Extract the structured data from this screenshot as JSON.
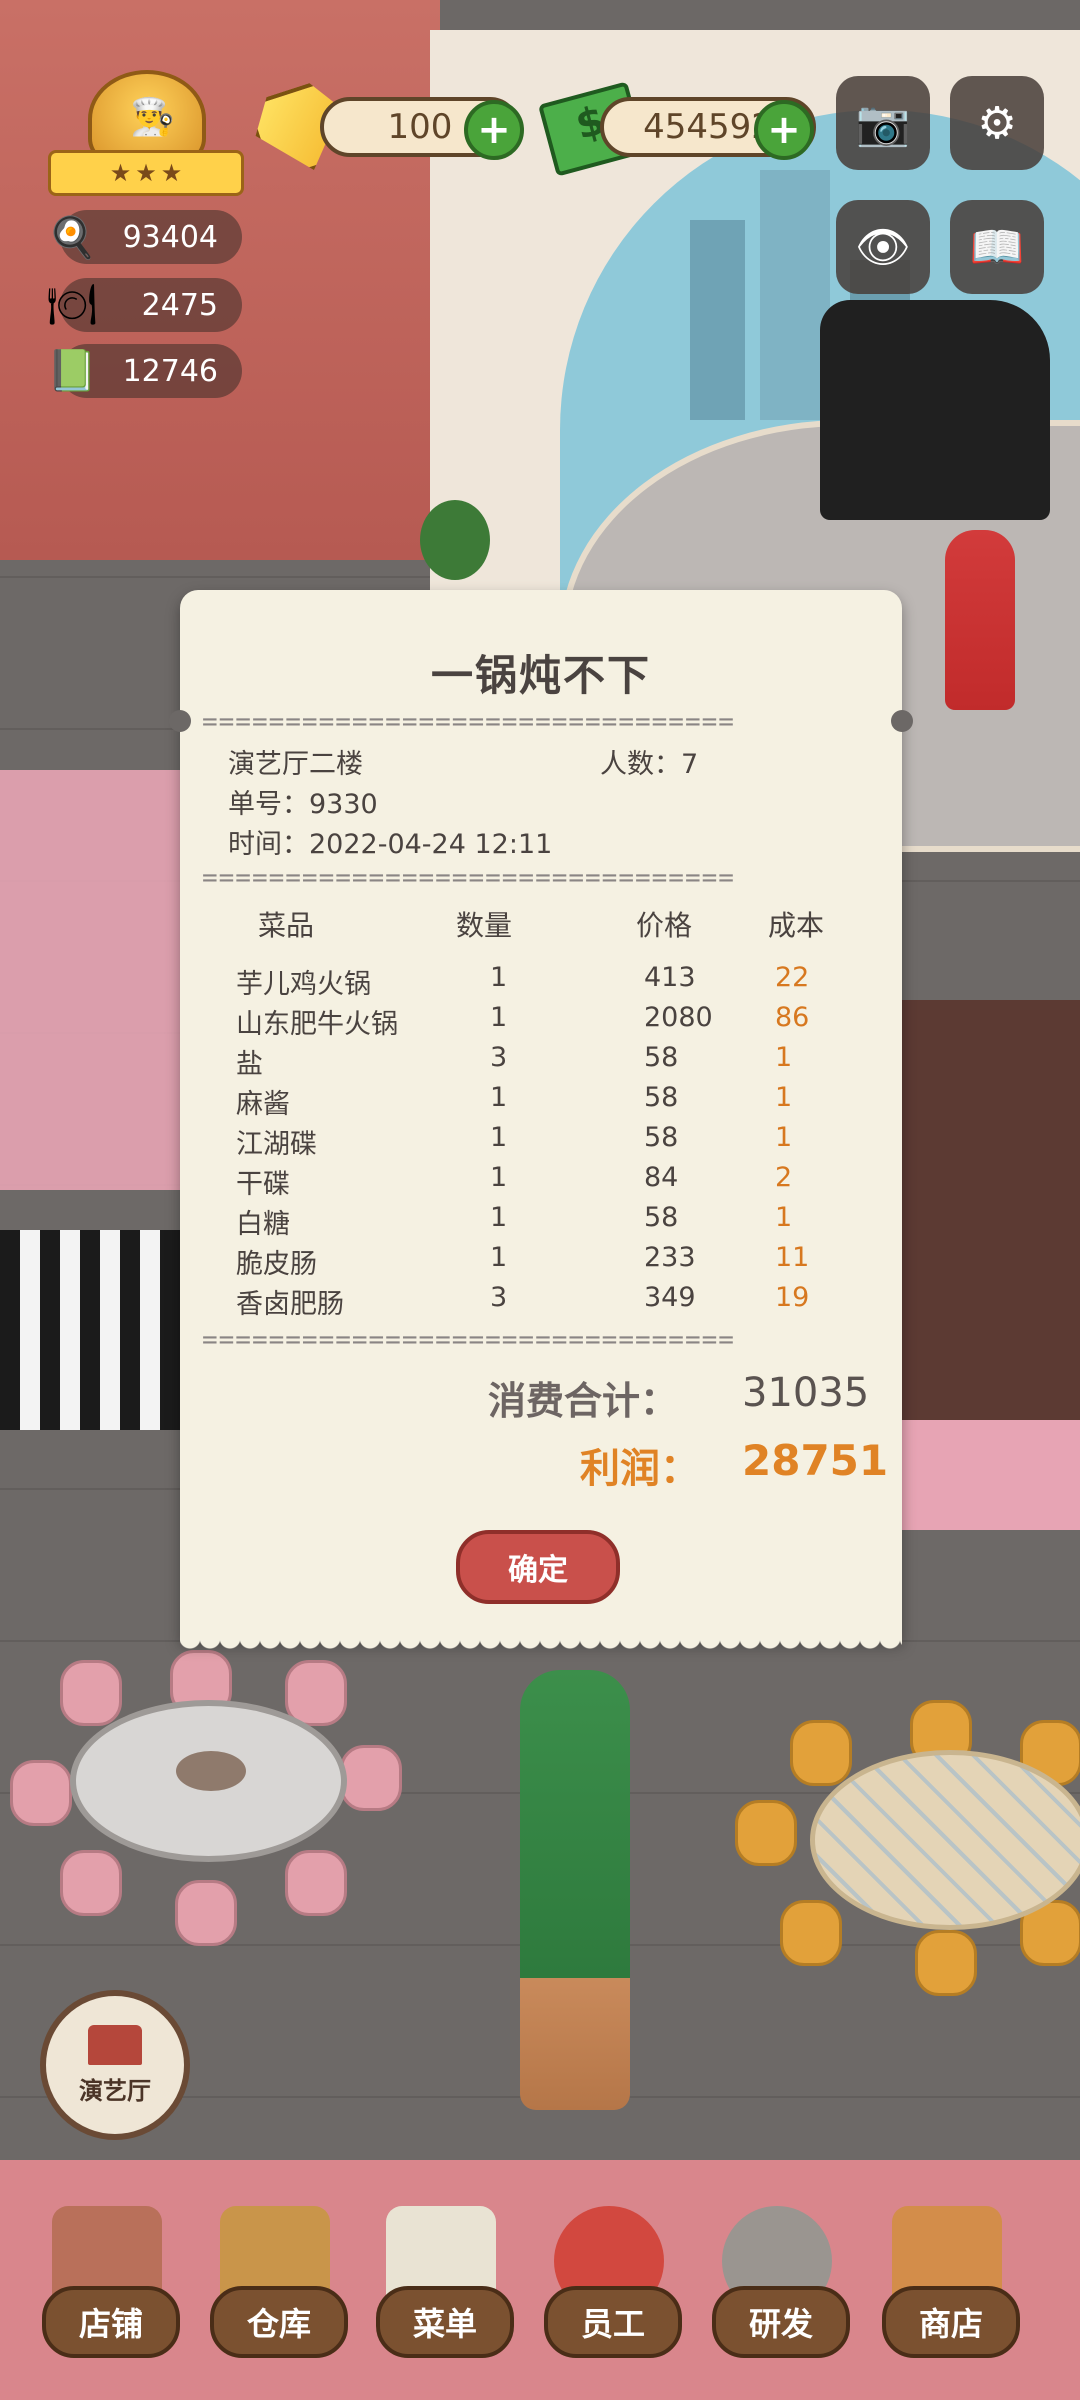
{
  "hud": {
    "gems": "100",
    "cash": "454592",
    "stat_1": "93404",
    "stat_2": "2475",
    "stat_3": "12746"
  },
  "receipt": {
    "title": "一锅炖不下",
    "location": "演艺厅二楼",
    "people_label": "人数：7",
    "order_label": "单号：9330",
    "time_label": "时间：2022-04-24 12:11",
    "dash_line": "================================",
    "columns": {
      "name": "菜品",
      "qty": "数量",
      "price": "价格",
      "cost": "成本"
    },
    "items": [
      {
        "name": "芋儿鸡火锅",
        "qty": "1",
        "price": "413",
        "cost": "22"
      },
      {
        "name": "山东肥牛火锅",
        "qty": "1",
        "price": "2080",
        "cost": "86"
      },
      {
        "name": "盐",
        "qty": "3",
        "price": "58",
        "cost": "1"
      },
      {
        "name": "麻酱",
        "qty": "1",
        "price": "58",
        "cost": "1"
      },
      {
        "name": "江湖碟",
        "qty": "1",
        "price": "58",
        "cost": "1"
      },
      {
        "name": "干碟",
        "qty": "1",
        "price": "84",
        "cost": "2"
      },
      {
        "name": "白糖",
        "qty": "1",
        "price": "58",
        "cost": "1"
      },
      {
        "name": "脆皮肠",
        "qty": "1",
        "price": "233",
        "cost": "11"
      },
      {
        "name": "香卤肥肠",
        "qty": "3",
        "price": "349",
        "cost": "19"
      }
    ],
    "total_label": "消费合计：",
    "total_value": "31035",
    "profit_label": "利润：",
    "profit_value": "28751",
    "confirm": "确定"
  },
  "floor_badge": "演艺厅",
  "nav": [
    "店铺",
    "仓库",
    "菜单",
    "员工",
    "研发",
    "商店"
  ],
  "colors": {
    "accent_orange": "#e08325",
    "confirm_red": "#c9504b",
    "plus_green": "#4aa43a"
  }
}
